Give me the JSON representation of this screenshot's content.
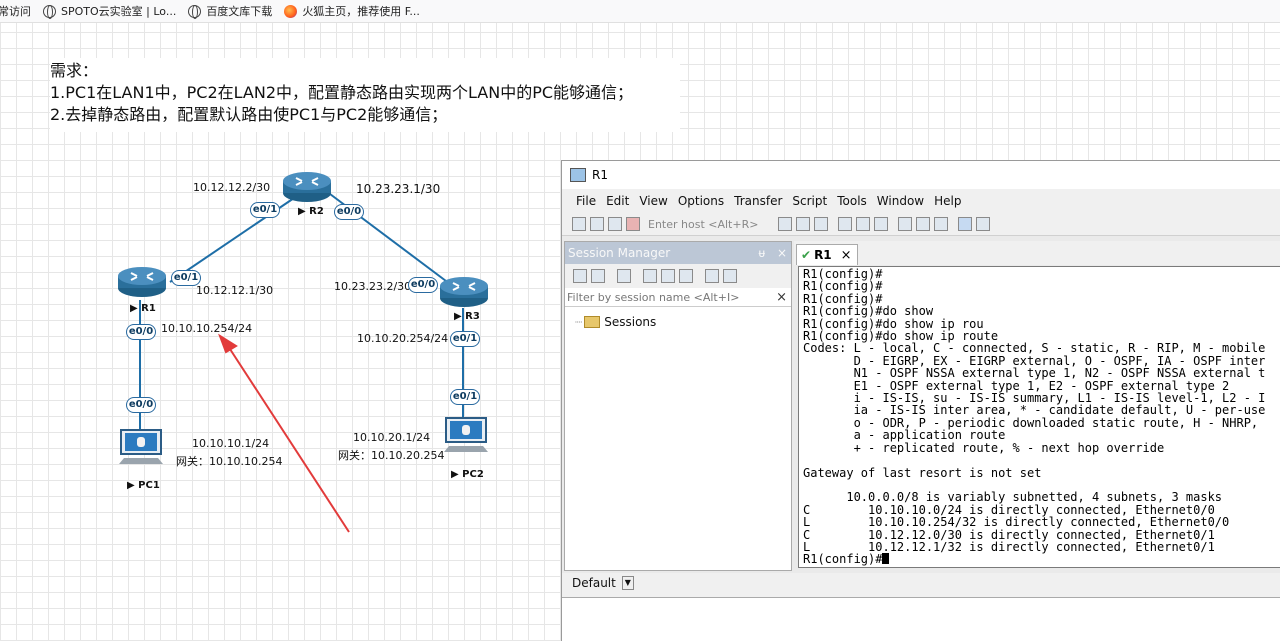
{
  "bookmarks": [
    {
      "label": "常访问",
      "icon": ""
    },
    {
      "label": "SPOTO云实验室 | Lo...",
      "icon": "globe-icon"
    },
    {
      "label": "百度文库下载",
      "icon": "globe-icon"
    },
    {
      "label": "火狐主页，推荐使用 F...",
      "icon": "firefox-icon"
    }
  ],
  "requirements": {
    "title": "需求：",
    "line1": "1.PC1在LAN1中，PC2在LAN2中，配置静态路由实现两个LAN中的PC能够通信；",
    "line2": "2.去掉静态路由，配置默认路由使PC1与PC2能够通信；"
  },
  "topology": {
    "devices": {
      "r1": "R1",
      "r2": "R2",
      "r3": "R3",
      "pc1": "PC1",
      "pc2": "PC2"
    },
    "ports": {
      "r2_e01": "e0/1",
      "r2_e00": "e0/0",
      "r1_e01": "e0/1",
      "r1_e00": "e0/0",
      "r3_e00": "e0/0",
      "r3_e01": "e0/1",
      "pc1_e00": "e0/0",
      "pc2_e01": "e0/1"
    },
    "addresses": {
      "r2_left": "10.12.12.2/30",
      "r2_right": "10.23.23.1/30",
      "r1_e01": "10.12.12.1/30",
      "r1_e00": "10.10.10.254/24",
      "r3_e00": "10.23.23.2/30",
      "r3_e01": "10.10.20.254/24",
      "pc1_ip": "10.10.10.1/24",
      "pc1_gw": "网关：10.10.10.254",
      "pc2_ip": "10.10.20.1/24",
      "pc2_gw": "网关：10.10.20.254"
    },
    "colors": {
      "link": "#1e6ea7",
      "router": "#2a6f9b",
      "arrow": "#e23b3b"
    }
  },
  "terminal_window": {
    "title": "R1",
    "menu": [
      "File",
      "Edit",
      "View",
      "Options",
      "Transfer",
      "Script",
      "Tools",
      "Window",
      "Help"
    ],
    "host_placeholder": "Enter host <Alt+R>",
    "session_manager": {
      "title": "Session Manager",
      "pin": "ᵾ",
      "close": "×",
      "filter_placeholder": "Filter by session name <Alt+I>",
      "filter_clear": "×",
      "root": "Sessions"
    },
    "tab": {
      "label": "R1",
      "close": "×"
    },
    "terminal_lines": [
      "R1(config)#",
      "R1(config)#",
      "R1(config)#",
      "R1(config)#do show",
      "R1(config)#do show ip rou",
      "R1(config)#do show ip route",
      "Codes: L - local, C - connected, S - static, R - RIP, M - mobile",
      "       D - EIGRP, EX - EIGRP external, O - OSPF, IA - OSPF inter",
      "       N1 - OSPF NSSA external type 1, N2 - OSPF NSSA external t",
      "       E1 - OSPF external type 1, E2 - OSPF external type 2",
      "       i - IS-IS, su - IS-IS summary, L1 - IS-IS level-1, L2 - I",
      "       ia - IS-IS inter area, * - candidate default, U - per-use",
      "       o - ODR, P - periodic downloaded static route, H - NHRP,",
      "       a - application route",
      "       + - replicated route, % - next hop override",
      "",
      "Gateway of last resort is not set",
      "",
      "      10.0.0.0/8 is variably subnetted, 4 subnets, 3 masks",
      "C        10.10.10.0/24 is directly connected, Ethernet0/0",
      "L        10.10.10.254/32 is directly connected, Ethernet0/0",
      "C        10.12.12.0/30 is directly connected, Ethernet0/1",
      "L        10.12.12.1/32 is directly connected, Ethernet0/1",
      "R1(config)#"
    ],
    "command_target": "Default"
  }
}
